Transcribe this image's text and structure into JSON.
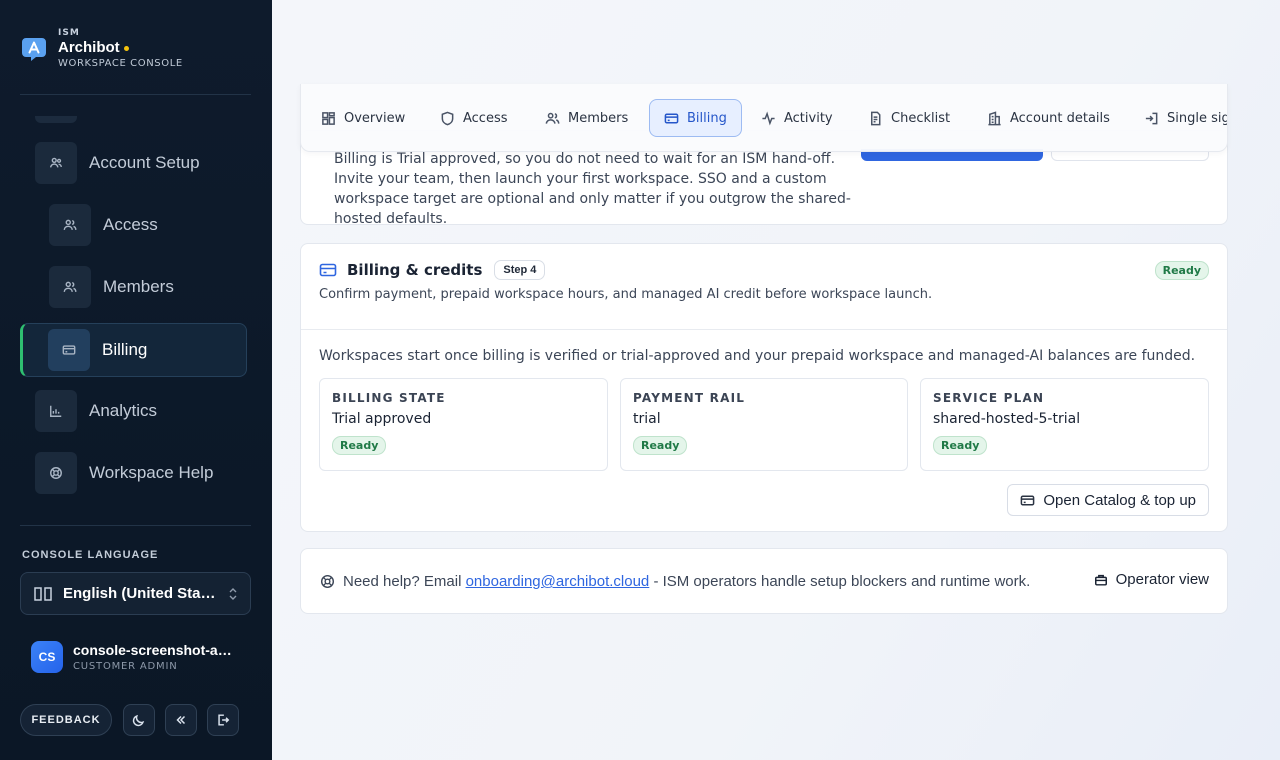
{
  "brand": {
    "org": "ISM",
    "name": "Archibot",
    "subtitle": "WORKSPACE CONSOLE",
    "accent_dot_color": "#f4c20d"
  },
  "sidebar": {
    "items": [
      {
        "label": "Account Setup",
        "icon": "users-cog-icon",
        "active": false
      },
      {
        "label": "Access",
        "icon": "users-icon",
        "active": false
      },
      {
        "label": "Members",
        "icon": "users-icon",
        "active": false
      },
      {
        "label": "Billing",
        "icon": "credit-card-icon",
        "active": true
      },
      {
        "label": "Analytics",
        "icon": "bar-chart-icon",
        "active": false
      },
      {
        "label": "Workspace Help",
        "icon": "life-buoy-icon",
        "active": false
      }
    ],
    "language_label": "CONSOLE LANGUAGE",
    "language_value": "English (United States)",
    "user": {
      "initials": "CS",
      "name": "console-screenshot-admin",
      "role": "CUSTOMER ADMIN"
    },
    "feedback_label": "FEEDBACK",
    "active_color": "#2fbf71"
  },
  "tabs": [
    {
      "label": "Overview",
      "icon": "grid-icon"
    },
    {
      "label": "Access",
      "icon": "shield-icon"
    },
    {
      "label": "Members",
      "icon": "users-icon"
    },
    {
      "label": "Billing",
      "icon": "credit-card-icon",
      "active": true
    },
    {
      "label": "Activity",
      "icon": "activity-icon"
    },
    {
      "label": "Checklist",
      "icon": "checklist-icon"
    },
    {
      "label": "Account details",
      "icon": "building-icon"
    },
    {
      "label": "Single sign-on",
      "icon": "sign-in-icon"
    }
  ],
  "intro": {
    "text": "Billing is Trial approved, so you do not need to wait for an ISM hand-off. Invite your team, then launch your first workspace. SSO and a custom workspace target are optional and only matter if you outgrow the shared-hosted defaults."
  },
  "billing": {
    "title": "Billing & credits",
    "step": "Step 4",
    "status": "Ready",
    "subtitle": "Confirm payment, prepaid workspace hours, and managed AI credit before workspace launch.",
    "description": "Workspaces start once billing is verified or trial-approved and your prepaid workspace and managed-AI balances are funded.",
    "stats": [
      {
        "label": "BILLING STATE",
        "value": "Trial approved",
        "status": "Ready"
      },
      {
        "label": "PAYMENT RAIL",
        "value": "trial",
        "status": "Ready"
      },
      {
        "label": "SERVICE PLAN",
        "value": "shared-hosted-5-trial",
        "status": "Ready"
      }
    ],
    "catalog_button": "Open Catalog & top up"
  },
  "help": {
    "prefix": "Need help? Email",
    "email": "onboarding@archibot.cloud",
    "suffix": "- ISM operators handle setup blockers and runtime work.",
    "operator_button": "Operator view"
  },
  "colors": {
    "primary": "#2f66e0",
    "ready_text": "#207a47",
    "ready_bg": "#e4f5ea"
  }
}
